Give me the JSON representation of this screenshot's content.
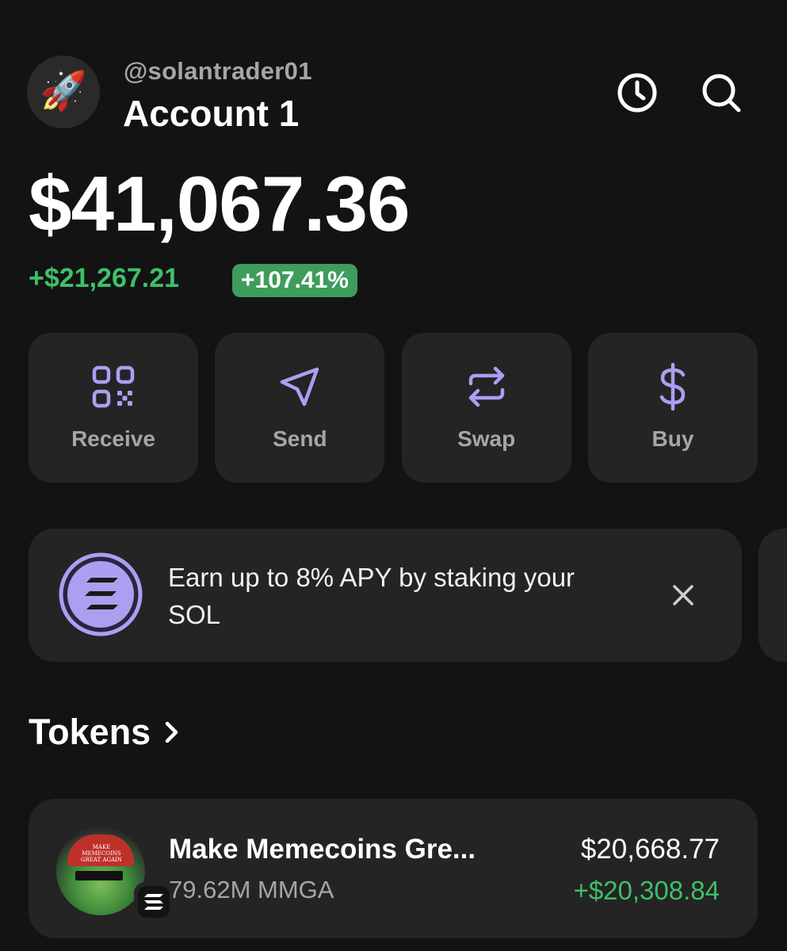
{
  "header": {
    "username": "@solantrader01",
    "account_name": "Account 1",
    "avatar_emoji": "🚀",
    "history_icon": "clock-icon",
    "search_icon": "search-icon"
  },
  "balance": {
    "total": "$41,067.36",
    "change_amount": "+$21,267.21",
    "change_percent": "+107.41%"
  },
  "actions": [
    {
      "label": "Receive",
      "icon": "qr-code-icon"
    },
    {
      "label": "Send",
      "icon": "paper-plane-icon"
    },
    {
      "label": "Swap",
      "icon": "swap-arrows-icon"
    },
    {
      "label": "Buy",
      "icon": "dollar-icon"
    }
  ],
  "promo": {
    "text": "Earn up to 8% APY by staking your SOL",
    "icon": "solana-logo-icon",
    "close_icon": "close-icon"
  },
  "tokens_section": {
    "title": "Tokens",
    "chevron_icon": "chevron-right-icon"
  },
  "tokens": [
    {
      "name": "Make Memecoins Gre...",
      "amount": "79.62M MMGA",
      "value": "$20,668.77",
      "change": "+$20,308.84",
      "image_hat_text": "MAKE MEMECOINS GREAT AGAIN",
      "chain_badge_icon": "solana-badge-icon"
    }
  ],
  "colors": {
    "background": "#131313",
    "card": "#242424",
    "accent_purple": "#ab9ff2",
    "positive_green": "#3fbf6a",
    "badge_green": "#3e9c5c",
    "muted_text": "#a6a6a6"
  }
}
